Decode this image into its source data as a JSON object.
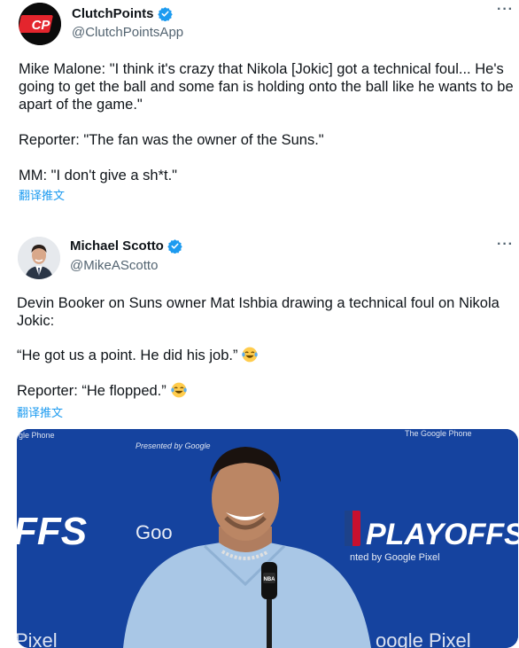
{
  "tweets": [
    {
      "author_name": "ClutchPoints",
      "handle": "@ClutchPointsApp",
      "avatar_text": "CP",
      "paragraphs": [
        "Mike Malone: \"I think it's crazy that Nikola [Jokic] got a technical foul... He's going to get the ball and some fan is holding onto the ball like he wants to be apart of the game.\"",
        "Reporter: \"The fan was the owner of the Suns.\"",
        "MM: \"I don't give a sh*t.\""
      ],
      "translate_label": "翻译推文",
      "more_label": "···"
    },
    {
      "author_name": "Michael Scotto",
      "handle": "@MikeAScotto",
      "paragraphs": [
        "Devin Booker on Suns owner Mat Ishbia drawing a technical foul on Nikola Jokic:",
        "“He got us a point. He did his job.”",
        "Reporter: “He flopped.”"
      ],
      "emoji": "face-with-tears-of-joy",
      "translate_label": "翻译推文",
      "more_label": "···",
      "media": {
        "backdrop_texts": [
          "gle Phone",
          "The Google Phone",
          "Presented by Google",
          "FFS",
          "Goo",
          "PLAYOFFS",
          "nted by Google Pixel",
          "Pixel",
          "oogle Pixel"
        ],
        "mic_label": "NBA"
      }
    }
  ],
  "colors": {
    "verified": "#1d9bf0",
    "link": "#1d9bf0",
    "cp_red": "#e4252d",
    "backdrop_blue": "#1a49a8"
  }
}
